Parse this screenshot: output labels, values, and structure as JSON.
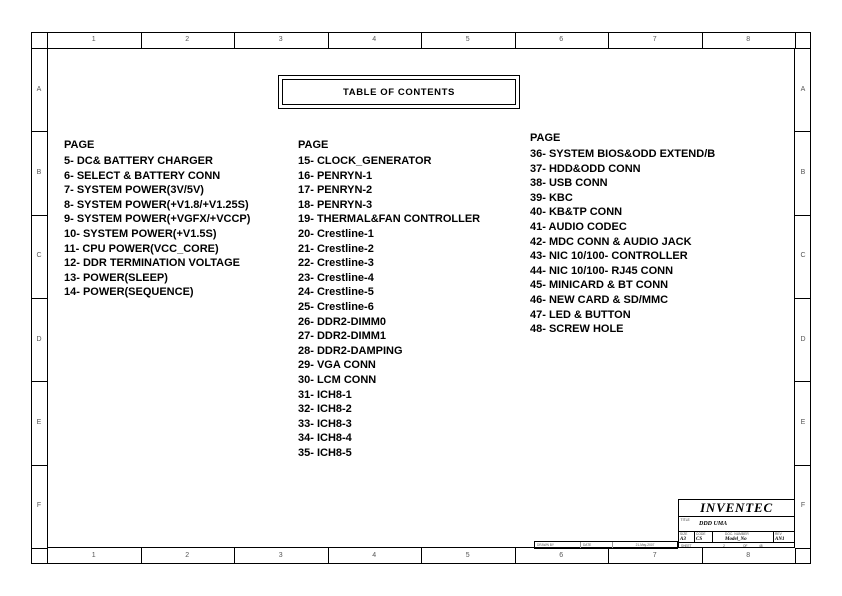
{
  "document": {
    "title_box": "TABLE OF CONTENTS"
  },
  "frame": {
    "column_zones": [
      "1",
      "2",
      "3",
      "4",
      "5",
      "6",
      "7",
      "8"
    ],
    "row_zones": [
      "A",
      "B",
      "C",
      "D",
      "E",
      "F"
    ]
  },
  "contents": {
    "columns": [
      {
        "heading": "PAGE",
        "entries": [
          "5- DC& BATTERY CHARGER",
          "6- SELECT & BATTERY CONN",
          "7- SYSTEM POWER(3V/5V)",
          "8- SYSTEM POWER(+V1.8/+V1.25S)",
          "9- SYSTEM POWER(+VGFX/+VCCP)",
          "10- SYSTEM POWER(+V1.5S)",
          "11- CPU POWER(VCC_CORE)",
          "12- DDR TERMINATION VOLTAGE",
          "13- POWER(SLEEP)",
          "14- POWER(SEQUENCE)"
        ]
      },
      {
        "heading": "PAGE",
        "entries": [
          "15- CLOCK_GENERATOR",
          "16- PENRYN-1",
          "17- PENRYN-2",
          "18- PENRYN-3",
          "19- THERMAL&FAN CONTROLLER",
          "20- Crestline-1",
          "21- Crestline-2",
          "22- Crestline-3",
          "23- Crestline-4",
          "24- Crestline-5",
          "25- Crestline-6",
          "26- DDR2-DIMM0",
          "27- DDR2-DIMM1",
          "28- DDR2-DAMPING",
          "29- VGA CONN",
          "30- LCM CONN",
          "31- ICH8-1",
          "32- ICH8-2",
          "33- ICH8-3",
          "34- ICH8-4",
          "35- ICH8-5"
        ]
      },
      {
        "heading": "PAGE",
        "entries": [
          "36- SYSTEM BIOS&ODD EXTEND/B",
          "37- HDD&ODD CONN",
          "38- USB CONN",
          "39- KBC",
          "40- KB&TP CONN",
          "41- AUDIO CODEC",
          "42- MDC CONN & AUDIO JACK",
          "43- NIC 10/100- CONTROLLER",
          "44- NIC 10/100- RJ45 CONN",
          "45- MINICARD & BT CONN",
          "46- NEW CARD & SD/MMC",
          "47- LED & BUTTON",
          "48- SCREW  HOLE"
        ]
      }
    ]
  },
  "title_block": {
    "company": "INVENTEC",
    "title_label": "TITLE",
    "title_value": "DDD UMA",
    "size_label": "SIZE",
    "size_value": "A3",
    "code_label": "CODE",
    "code_value": "CS",
    "docnum_label": "DOC. NUMBER",
    "docnum_value": "Model_No",
    "rev_label": "REV",
    "rev_value": "AN1",
    "sheet_label": "SHEET",
    "sheet_value": "2",
    "sheet_of": "OF",
    "sheet_total": "48"
  },
  "bottom_strip": {
    "drawn_label": "DRAWN BY",
    "date_label": "DATE",
    "date_value": "21-May-2007"
  }
}
